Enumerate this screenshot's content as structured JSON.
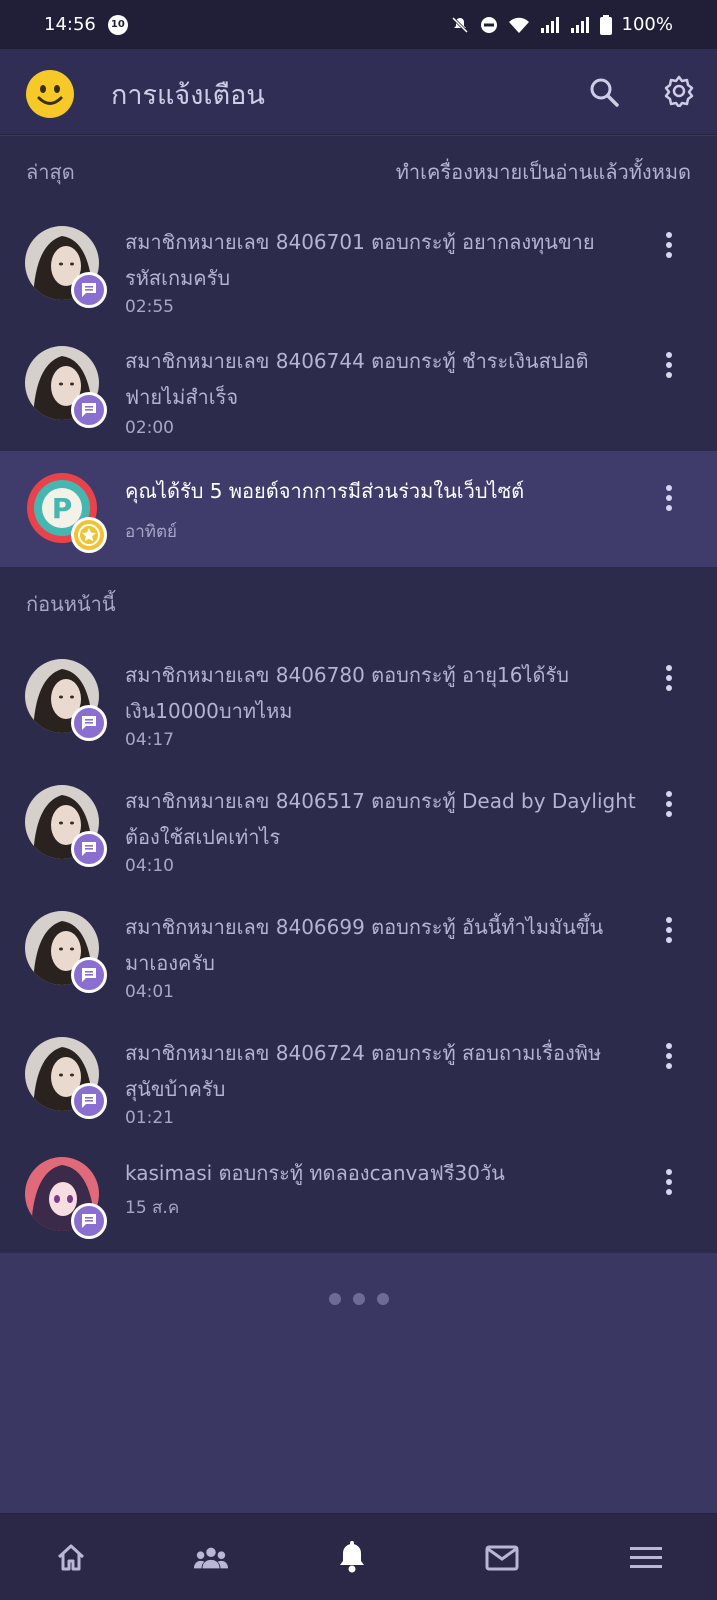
{
  "status_bar": {
    "time": "14:56",
    "notification_badge": "10",
    "battery": "100%"
  },
  "app_bar": {
    "title": "การแจ้งเตือน"
  },
  "latest": {
    "header": "ล่าสุด",
    "mark_all_read": "ทำเครื่องหมายเป็นอ่านแล้วทั้งหมด",
    "items": [
      {
        "line1": "สมาชิกหมายเลข 8406701 ตอบกระทู้ อยากลงทุนขาย",
        "line2": "รหัสเกมครับ",
        "time": "02:55"
      },
      {
        "line1": "สมาชิกหมายเลข 8406744 ตอบกระทู้ ชำระเงินสปอติ",
        "line2": "ฟายไม่สำเร็จ",
        "time": "02:00"
      },
      {
        "line1": "คุณได้รับ 5 พอยต์จากการมีส่วนร่วมในเว็บไซต์",
        "time": "อาทิตย์"
      }
    ]
  },
  "older": {
    "header": "ก่อนหน้านี้",
    "items": [
      {
        "line1": "สมาชิกหมายเลข 8406780 ตอบกระทู้ อายุ16ได้รับ",
        "line2": "เงิน10000บาทไหม",
        "time": "04:17"
      },
      {
        "line1": "สมาชิกหมายเลข 8406517 ตอบกระทู้ Dead by Daylight",
        "line2": "ต้องใช้สเปคเท่าไร",
        "time": "04:10"
      },
      {
        "line1": "สมาชิกหมายเลข 8406699 ตอบกระทู้ อันนี้ทำไมมันขึ้น",
        "line2": "มาเองครับ",
        "time": "04:01"
      },
      {
        "line1": "สมาชิกหมายเลข 8406724 ตอบกระทู้ สอบถามเรื่องพิษ",
        "line2": "สุนัขบ้าครับ",
        "time": "01:21"
      },
      {
        "line1": "kasimasi ตอบกระทู้ ทดลองcanvaฟรี30วัน",
        "time": "15 ส.ค"
      }
    ]
  },
  "colors": {
    "background": "#3a3862",
    "list_bg": "#2d2b4c",
    "highlight_bg": "#3f3c6b",
    "badge_purple": "#8b6fd0",
    "badge_gold": "#f1c232"
  },
  "icons": [
    "smiley-icon",
    "search-icon",
    "gear-icon",
    "comment-icon",
    "star-icon",
    "more-vert-icon",
    "home-icon",
    "community-icon",
    "bell-icon",
    "mail-icon",
    "menu-icon"
  ]
}
